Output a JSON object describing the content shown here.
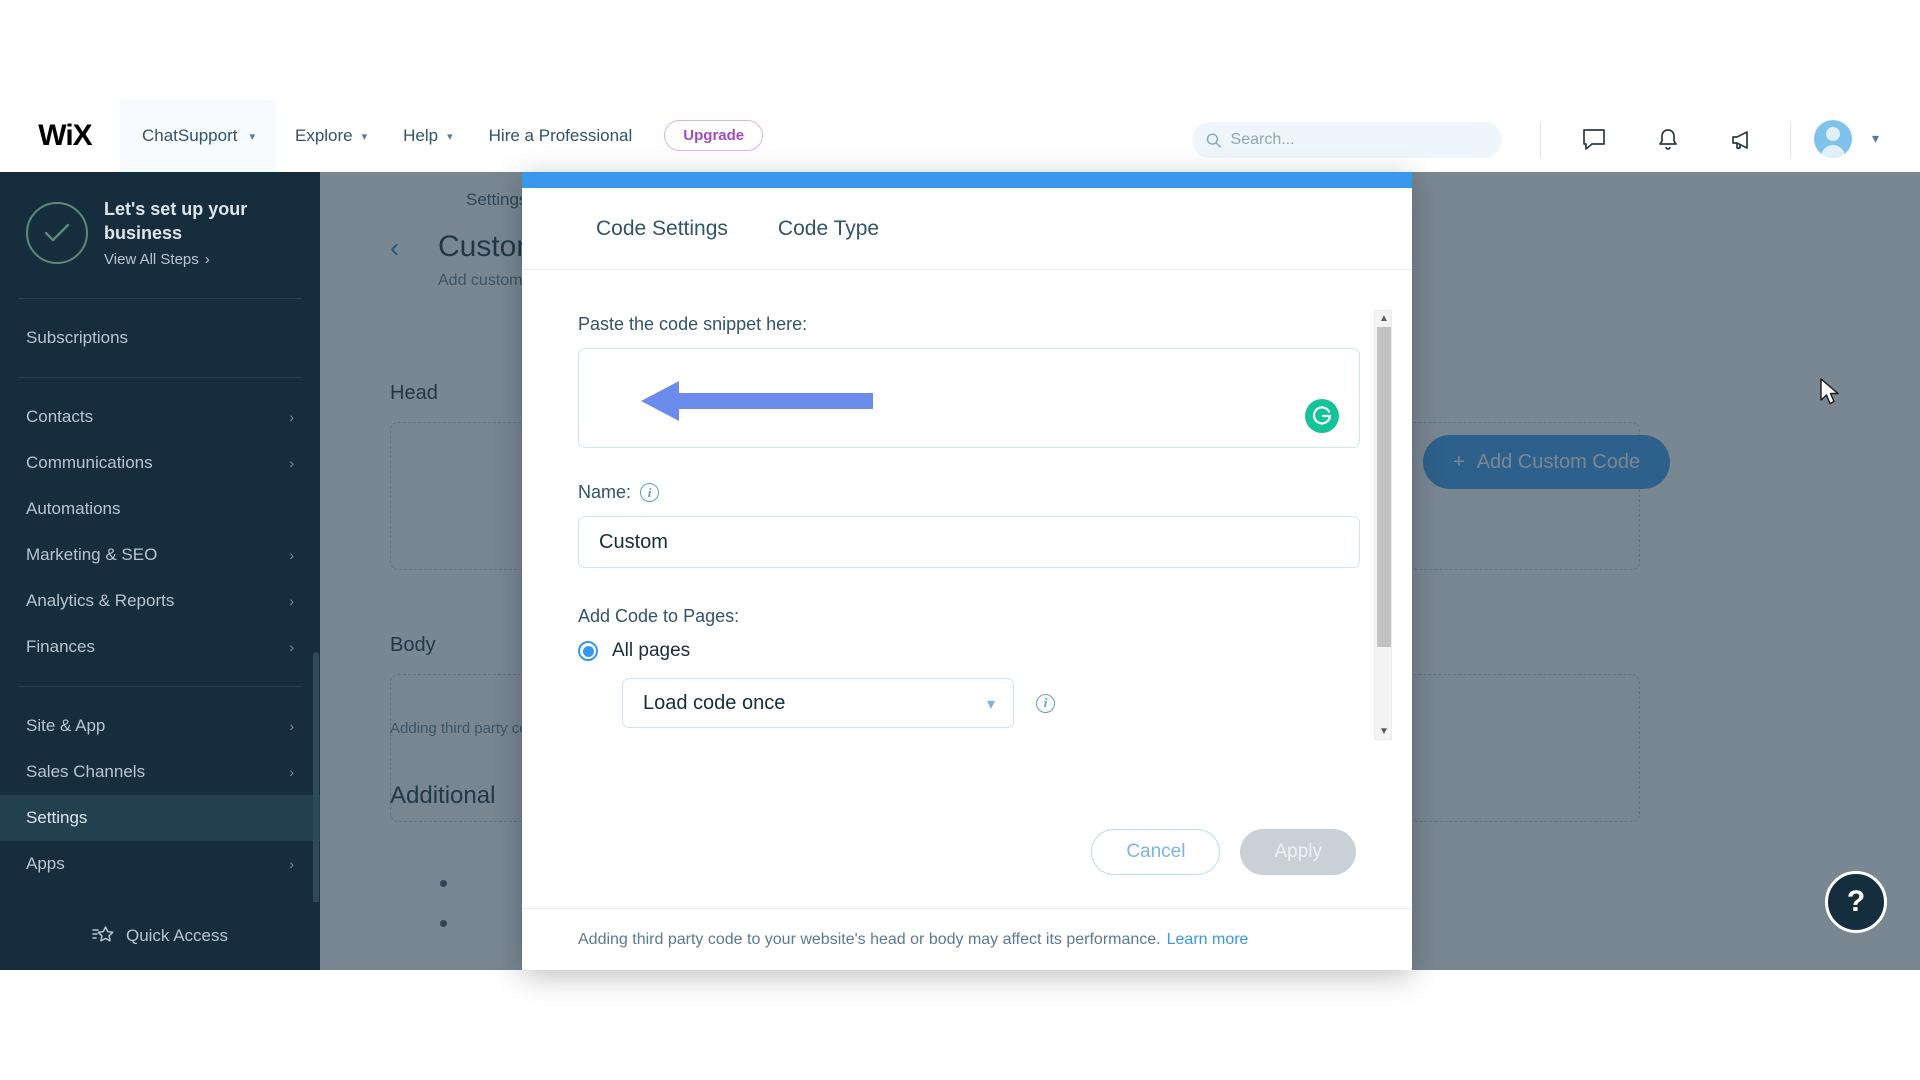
{
  "header": {
    "logo": "WiX",
    "site_name": "ChatSupport",
    "nav": [
      {
        "label": "Explore",
        "has_chevron": true
      },
      {
        "label": "Help",
        "has_chevron": true
      },
      {
        "label": "Hire a Professional",
        "has_chevron": false
      }
    ],
    "upgrade_label": "Upgrade",
    "search_placeholder": "Search...",
    "icons": [
      "chat-icon",
      "bell-icon",
      "megaphone-icon"
    ],
    "avatar_name": "avatar"
  },
  "sidebar": {
    "setup": {
      "title": "Let's set up your business",
      "link": "View All Steps",
      "chevron": "›"
    },
    "groups": [
      {
        "items": [
          {
            "label": "Subscriptions",
            "arrow": ""
          }
        ]
      },
      {
        "items": [
          {
            "label": "Contacts",
            "arrow": "›"
          },
          {
            "label": "Communications",
            "arrow": "›"
          },
          {
            "label": "Automations",
            "arrow": ""
          },
          {
            "label": "Marketing & SEO",
            "arrow": "›"
          },
          {
            "label": "Analytics & Reports",
            "arrow": "›"
          },
          {
            "label": "Finances",
            "arrow": "›"
          }
        ]
      },
      {
        "items": [
          {
            "label": "Site & App",
            "arrow": "›"
          },
          {
            "label": "Sales Channels",
            "arrow": "›"
          },
          {
            "label": "Settings",
            "arrow": "",
            "active": true
          },
          {
            "label": "Apps",
            "arrow": "›"
          }
        ]
      }
    ],
    "quick_access": "Quick Access"
  },
  "main": {
    "breadcrumb": "Settings",
    "page_title": "Custom Code",
    "page_subtitle": "Add custom code",
    "head_label": "Head",
    "body_label": "Body",
    "note": "Adding third party code to your website's head",
    "additional_title": "Additional",
    "add_code_button": "Add Custom Code",
    "add_code_plus": "+"
  },
  "modal": {
    "tabs": [
      {
        "label": "Code Settings",
        "active": true
      },
      {
        "label": "Code Type",
        "active": false
      }
    ],
    "snippet_label": "Paste the code snippet here:",
    "snippet_value": "",
    "grammarly_icon": "G",
    "name_label": "Name:",
    "name_value": "Custom",
    "pages_label": "Add Code to Pages:",
    "radio_all_pages": "All pages",
    "load_option": "Load code once",
    "cancel_label": "Cancel",
    "apply_label": "Apply",
    "footer_note": "Adding third party code to your website's head or body may affect its performance.",
    "footer_link": "Learn more"
  },
  "help": {
    "label": "?"
  },
  "colors": {
    "brand_blue": "#3899ec",
    "sidebar_dark": "#162d3d",
    "grammarly_green": "#15c39a",
    "upgrade_purple": "#a24ac4",
    "annotation_arrow": "#6c8ced"
  }
}
